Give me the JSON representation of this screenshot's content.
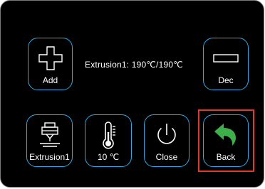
{
  "buttons": {
    "add": {
      "label": "Add",
      "icon": "plus-icon"
    },
    "dec": {
      "label": "Dec",
      "icon": "minus-icon"
    },
    "extrusion": {
      "label": "Extrusion1",
      "icon": "extruder-icon"
    },
    "temperature": {
      "label": "10 ℃",
      "icon": "thermometer-icon"
    },
    "close": {
      "label": "Close",
      "icon": "power-icon"
    },
    "back": {
      "label": "Back",
      "icon": "back-arrow-icon"
    }
  },
  "status": {
    "text": "Extrusion1:  190℃/190℃"
  },
  "colors": {
    "background": "#000000",
    "button_border": "#2fa9e8",
    "back_arrow": "#3eb049",
    "highlight": "#e03a2f"
  },
  "highlighted_button": "back"
}
